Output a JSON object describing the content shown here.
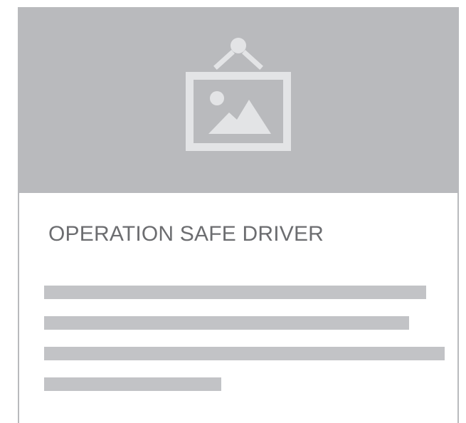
{
  "card": {
    "image_icon": "hanging-picture-frame-icon",
    "title": "OPERATION SAFE DRIVER",
    "description_lines": 4,
    "colors": {
      "placeholder_bg": "#b9babd",
      "icon": "#e3e4e6",
      "title_text": "#6c6d70",
      "text_placeholder": "#c2c3c6",
      "border": "#b9babd"
    }
  }
}
